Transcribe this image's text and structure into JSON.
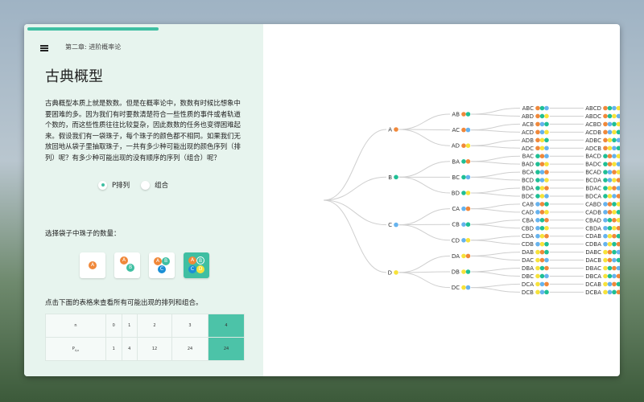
{
  "header": {
    "breadcrumb": "第二章: 进阶概率论",
    "progress_percent": 22
  },
  "page": {
    "title": "古典概型",
    "paragraph": "古典概型本质上就是数数。但是在概率论中，数数有时候比想象中要困难的多。因为我们有时要数清楚符合一些性质的事件或者轨道个数的，而这些性质往往比较复杂，因此数数的任务也变得困难起来。假设我们有一袋珠子，每个珠子的颜色都不相同。如果我们无放回地从袋子里抽取珠子，一共有多少种可能出现的颜色序列（排列）呢？有多少种可能出现的没有顺序的序列（组合）呢？"
  },
  "mode": {
    "options": [
      {
        "label": "P排列",
        "selected": true
      },
      {
        "label": "组合",
        "selected": false
      }
    ]
  },
  "bead_select": {
    "label": "选择袋子中珠子的数量：",
    "options": [
      [
        "A"
      ],
      [
        "A",
        "B"
      ],
      [
        "A",
        "B",
        "C"
      ],
      [
        "A",
        "B",
        "C",
        "D"
      ]
    ],
    "selected_index": 3
  },
  "table_section": {
    "label": "点击下面的表格来查看所有可能出现的排列和组合。",
    "row1_header": "n",
    "row2_header": "P",
    "row2_sub": "4,n",
    "n": [
      "0",
      "1",
      "2",
      "3",
      "4"
    ],
    "p": [
      "1",
      "4",
      "12",
      "24",
      "24"
    ],
    "selected_index": 4
  },
  "colors": {
    "A": "#f0883a",
    "B": "#1fbf95",
    "C": "#66b3ee",
    "D": "#f7e23a",
    "accent": "#3fbfa2"
  },
  "tree": {
    "level1": [
      "A",
      "B",
      "C",
      "D"
    ],
    "level2": [
      "AB",
      "AC",
      "AD",
      "BA",
      "BC",
      "BD",
      "CA",
      "CB",
      "CD",
      "DA",
      "DB",
      "DC"
    ],
    "level3": [
      "ABC",
      "ABD",
      "ACB",
      "ACD",
      "ADB",
      "ADC",
      "BAC",
      "BAD",
      "BCA",
      "BCD",
      "BDA",
      "BDC",
      "CAB",
      "CAD",
      "CBA",
      "CBD",
      "CDA",
      "CDB",
      "DAB",
      "DAC",
      "DBA",
      "DBC",
      "DCA",
      "DCB"
    ],
    "level4": [
      "ABCD",
      "ABDC",
      "ACBD",
      "ACDB",
      "ADBC",
      "ADCB",
      "BACD",
      "BADC",
      "BCAD",
      "BCDA",
      "BDAC",
      "BDCA",
      "CABD",
      "CADB",
      "CBAD",
      "CBDA",
      "CDAB",
      "CDBA",
      "DABC",
      "DACB",
      "DBAC",
      "DBCA",
      "DCAB",
      "DCBA"
    ]
  }
}
